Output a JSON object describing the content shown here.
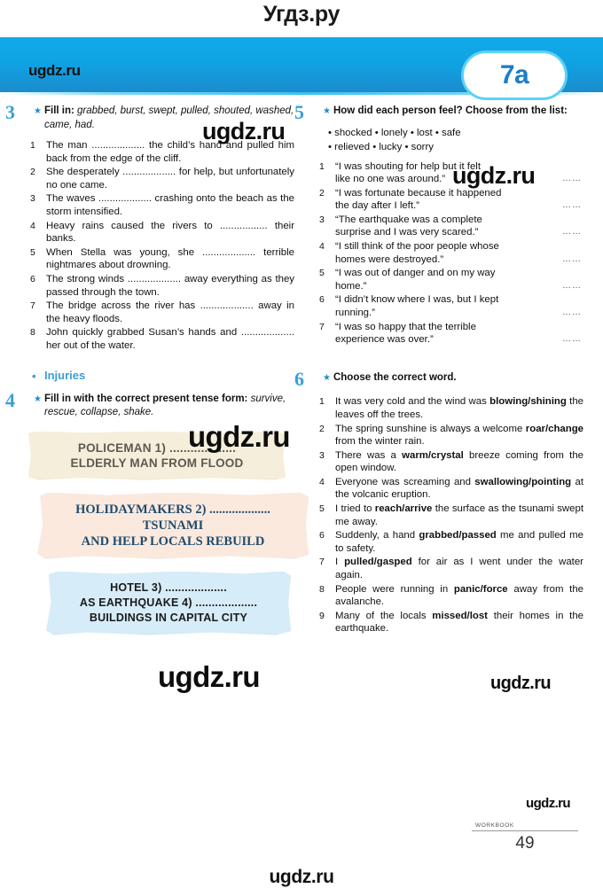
{
  "site": {
    "title": "Угдз.ру",
    "brand": "ugdz.ru",
    "watermark": "ugdz.ru"
  },
  "header": {
    "unit_badge": "7a"
  },
  "footer": {
    "workbook_label": "WORKBOOK",
    "page_number": "49"
  },
  "exercises": {
    "ex3": {
      "number": "3",
      "star": "★",
      "instruction_bold": "Fill in:",
      "instruction_italic": "grabbed, burst, swept, pulled, shouted, washed, came, had.",
      "items": [
        "The man ................... the child’s hand and pulled him back from the edge of the cliff.",
        "She desperately ................... for help, but unfortunately no one came.",
        "The waves ................... crashing onto the beach as the storm intensified.",
        "Heavy rains caused the rivers to ................. their banks.",
        "When Stella was young, she ................... terrible nightmares about drowning.",
        "The strong winds ................... away everything as they passed through the town.",
        "The bridge across the river has ................... away in the heavy floods.",
        "John quickly grabbed Susan’s hands and ................... her out of the water."
      ]
    },
    "injuries": {
      "bullet": "•",
      "label": "Injuries"
    },
    "ex4": {
      "number": "4",
      "star": "★",
      "instruction_bold": "Fill in with the correct present tense form:",
      "instruction_italic": "survive, rescue, collapse, shake.",
      "notes": [
        {
          "id": "note-policeman",
          "color": "#f4eeda",
          "lines": [
            "POLICEMAN 1) ...................",
            "ELDERLY MAN FROM FLOOD"
          ]
        },
        {
          "id": "note-holidaymakers",
          "color": "#fbe9de",
          "lines": [
            "HOLIDAYMAKERS 2) ...................",
            "TSUNAMI",
            "AND HELP LOCALS REBUILD"
          ]
        },
        {
          "id": "note-hotel",
          "color": "#d6ecf8",
          "lines": [
            "HOTEL 3) ...................",
            "AS EARTHQUAKE 4) ...................",
            "BUILDINGS IN CAPITAL CITY"
          ]
        }
      ]
    },
    "ex5": {
      "number": "5",
      "star": "★",
      "instruction_bold": "How did each person feel? Choose from the list:",
      "word_list_line1": "• shocked  • lonely  • lost  • safe",
      "word_list_line2": "• relieved  • lucky  • sorry",
      "items": [
        {
          "line1": "“I was shouting for help but it felt",
          "line2": "like no one was around.”",
          "answer_dots": "……"
        },
        {
          "line1": "“I was fortunate because it happened",
          "line2": "the day after I left.”",
          "answer_dots": "……"
        },
        {
          "line1": "“The earthquake was a complete",
          "line2": "surprise and I was very scared.”",
          "answer_dots": "……"
        },
        {
          "line1": "“I still think of the poor people whose",
          "line2": "homes were destroyed.”",
          "answer_dots": "……"
        },
        {
          "line1": "“I was out of danger and on my way",
          "line2": "home.”",
          "answer_dots": "……"
        },
        {
          "line1": "“I didn’t know where I was, but I kept",
          "line2": "running.”",
          "answer_dots": "……"
        },
        {
          "line1": "“I was so happy that the terrible",
          "line2": "experience was over.”",
          "answer_dots": "……"
        }
      ]
    },
    "ex6": {
      "number": "6",
      "star": "★",
      "instruction_bold": "Choose the correct word.",
      "items": [
        {
          "pre": "It was very cold and the wind was ",
          "choice": "blowing/shining",
          "post": " the leaves off the trees."
        },
        {
          "pre": "The spring sunshine is always a welcome ",
          "choice": "roar/change",
          "post": " from the winter rain."
        },
        {
          "pre": "There was a ",
          "choice": "warm/crystal",
          "post": " breeze coming from the open window."
        },
        {
          "pre": "Everyone was screaming and ",
          "choice": "swallowing/pointing",
          "post": " at the volcanic eruption."
        },
        {
          "pre": "I tried to ",
          "choice": "reach/arrive",
          "post": " the surface as the tsunami swept me away."
        },
        {
          "pre": "Suddenly, a hand ",
          "choice": "grabbed/passed",
          "post": " me and pulled me to safety."
        },
        {
          "pre": "I ",
          "choice": "pulled/gasped",
          "post": " for air as I went under the water again."
        },
        {
          "pre": "People were running in ",
          "choice": "panic/force",
          "post": " away from the avalanche."
        },
        {
          "pre": "Many of the locals ",
          "choice": "missed/lost",
          "post": " their homes in the earthquake."
        }
      ]
    }
  },
  "colors": {
    "banner_blue": "#13a9e8",
    "accent_blue": "#3a9fd6",
    "badge_text": "#1b7fc4",
    "note_cream": "#f4eeda",
    "note_peach": "#fbe9de",
    "note_blue": "#d6ecf8"
  }
}
